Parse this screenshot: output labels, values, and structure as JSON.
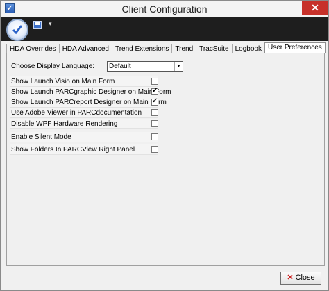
{
  "window": {
    "title": "Client Configuration",
    "close_glyph": "✕"
  },
  "ribbon": {
    "dropdown_glyph": "▾"
  },
  "tabs": [
    {
      "label": "HDA Overrides"
    },
    {
      "label": "HDA Advanced"
    },
    {
      "label": "Trend Extensions"
    },
    {
      "label": "Trend"
    },
    {
      "label": "TracSuite"
    },
    {
      "label": "Logbook"
    },
    {
      "label": "User Preferences",
      "active": true
    }
  ],
  "language": {
    "label": "Choose Display Language:",
    "value": "Default"
  },
  "options": [
    {
      "label": "Show Launch Visio on Main Form",
      "checked": false
    },
    {
      "label": "Show Launch PARCgraphic Designer on Main Form",
      "checked": true
    },
    {
      "label": "Show Launch PARCreport Designer on Main Form",
      "checked": true
    },
    {
      "label": "Use Adobe Viewer in PARCdocumentation",
      "checked": false
    },
    {
      "label": "Disable WPF Hardware Rendering",
      "checked": false
    },
    {
      "label": "Enable Silent Mode",
      "checked": false
    },
    {
      "label": "Show Folders In PARCView Right Panel",
      "checked": false
    }
  ],
  "footer": {
    "close_label": "Close",
    "close_icon": "✕"
  },
  "colors": {
    "close_red": "#c7312a",
    "ribbon_bg": "#1e1e1e"
  }
}
